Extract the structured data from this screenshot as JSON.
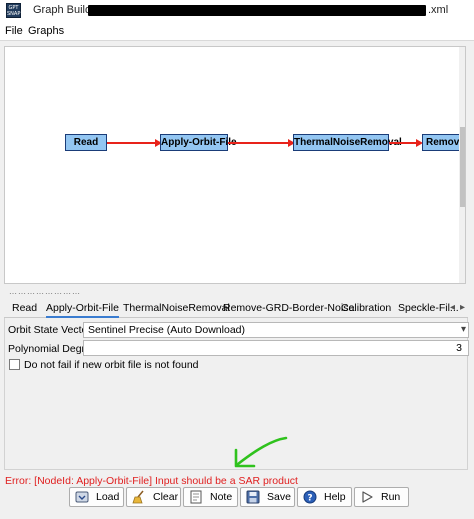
{
  "window": {
    "app_icon_text": "GPT SNAP",
    "title_prefix": "Graph Builder",
    "title_suffix": ".xml"
  },
  "menu": {
    "items": [
      "File",
      "Graphs"
    ]
  },
  "graph": {
    "nodes": [
      "Read",
      "Apply-Orbit-File",
      "ThermalNoiseRemoval",
      "Remove-G"
    ]
  },
  "tabs": {
    "items": [
      "Read",
      "Apply-Orbit-File",
      "ThermalNoiseRemoval",
      "Remove-GRD-Border-Noise",
      "Calibration",
      "Speckle-Fil..."
    ],
    "active_index": 1
  },
  "params": {
    "orbit_label": "Orbit State Vectors:",
    "orbit_value": "Sentinel Precise (Auto Download)",
    "poly_label": "Polynomial Degree:",
    "poly_value": "3",
    "nofail_label": "Do not fail if new orbit file is not found",
    "nofail_checked": false
  },
  "status": {
    "error_text": "Error: [NodeId: Apply-Orbit-File] Input should be a SAR product"
  },
  "buttons": {
    "load": "Load",
    "clear": "Clear",
    "note": "Note",
    "save": "Save",
    "help": "Help",
    "run": "Run"
  },
  "colors": {
    "node_fill": "#93c6f2",
    "node_border": "#1a3c78",
    "edge": "#e8231a",
    "error": "#e02020",
    "annotation": "#2fc21d"
  }
}
